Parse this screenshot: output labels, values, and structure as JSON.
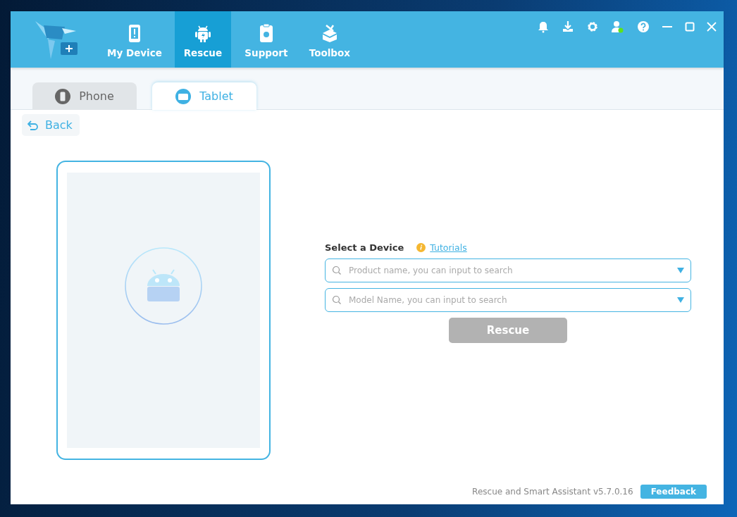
{
  "nav": [
    {
      "label": "My Device",
      "kind": "device",
      "selected": false
    },
    {
      "label": "Rescue",
      "kind": "android",
      "selected": true
    },
    {
      "label": "Support",
      "kind": "clipboard",
      "selected": false
    },
    {
      "label": "Toolbox",
      "kind": "toolbox",
      "selected": false
    }
  ],
  "tabs": [
    {
      "label": "Phone",
      "kind": "phone",
      "selected": false
    },
    {
      "label": "Tablet",
      "kind": "tablet",
      "selected": true
    }
  ],
  "back": "Back",
  "form": {
    "title": "Select a Device",
    "tutorials": "Tutorials",
    "fields": [
      {
        "placeholder": "Product name, you can input to search"
      },
      {
        "placeholder": "Model Name, you can input to search"
      }
    ],
    "button": {
      "label": "Rescue",
      "disabled": true
    }
  },
  "footer": {
    "version": "Rescue and Smart Assistant v5.7.0.16",
    "feedback": "Feedback"
  }
}
